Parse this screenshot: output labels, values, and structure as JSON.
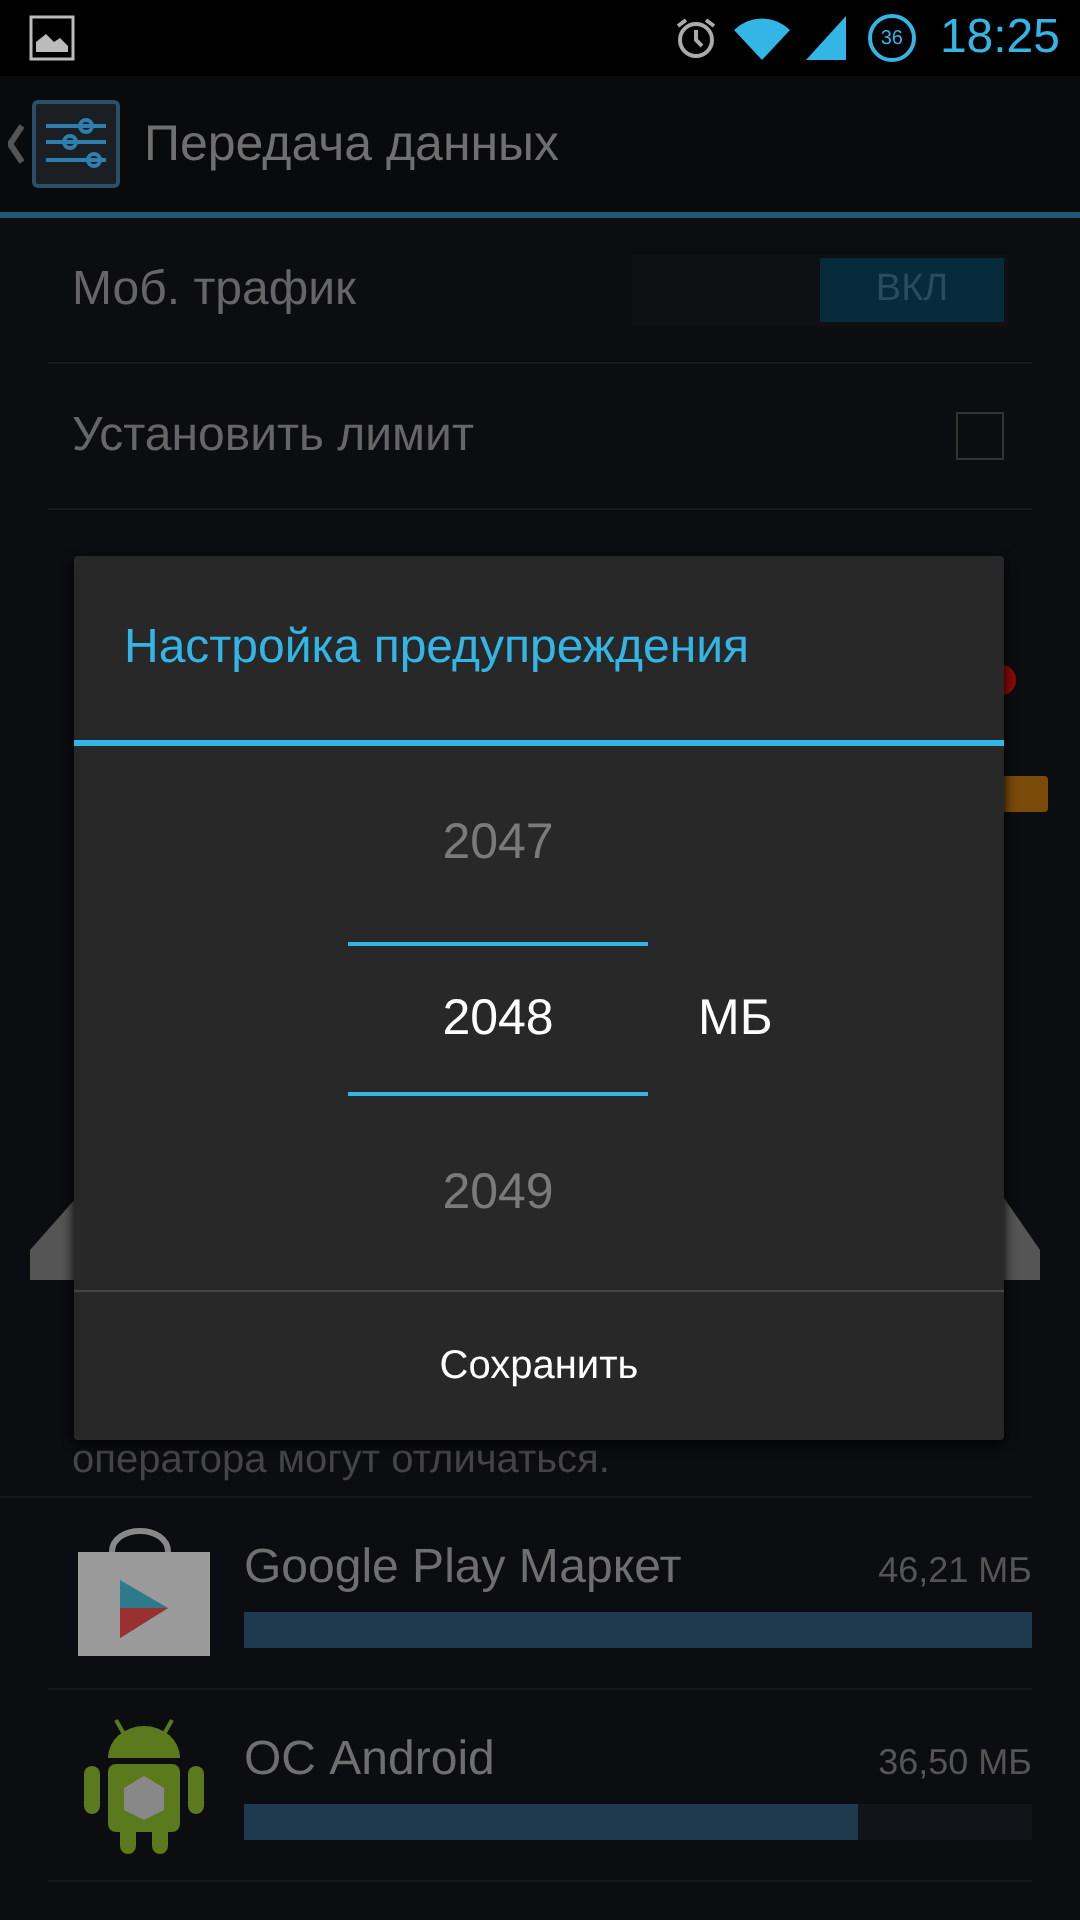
{
  "status_bar": {
    "battery": "36",
    "time": "18:25"
  },
  "action_bar": {
    "title": "Передача данных"
  },
  "settings": [
    {
      "kind": "switch",
      "label": "Моб. трафик",
      "on": true,
      "switch_text": "ВКЛ"
    },
    {
      "kind": "checkbox",
      "label": "Установить лимит",
      "checked": false
    }
  ],
  "note": "оператора могут отличаться.",
  "dialog": {
    "title": "Настройка предупреждения",
    "picker": [
      {
        "value": "2047",
        "selected": false
      },
      {
        "value": "2048",
        "selected": true
      },
      {
        "value": "2049",
        "selected": false
      }
    ],
    "unit": "МБ",
    "button": "Сохранить"
  },
  "apps": [
    {
      "kind": "play-store",
      "name": "Google Play Маркет",
      "usage": "46,21 МБ",
      "level": 1.0
    },
    {
      "kind": "android",
      "name": "ОС Android",
      "usage": "36,50 МБ",
      "level": 0.78
    }
  ]
}
